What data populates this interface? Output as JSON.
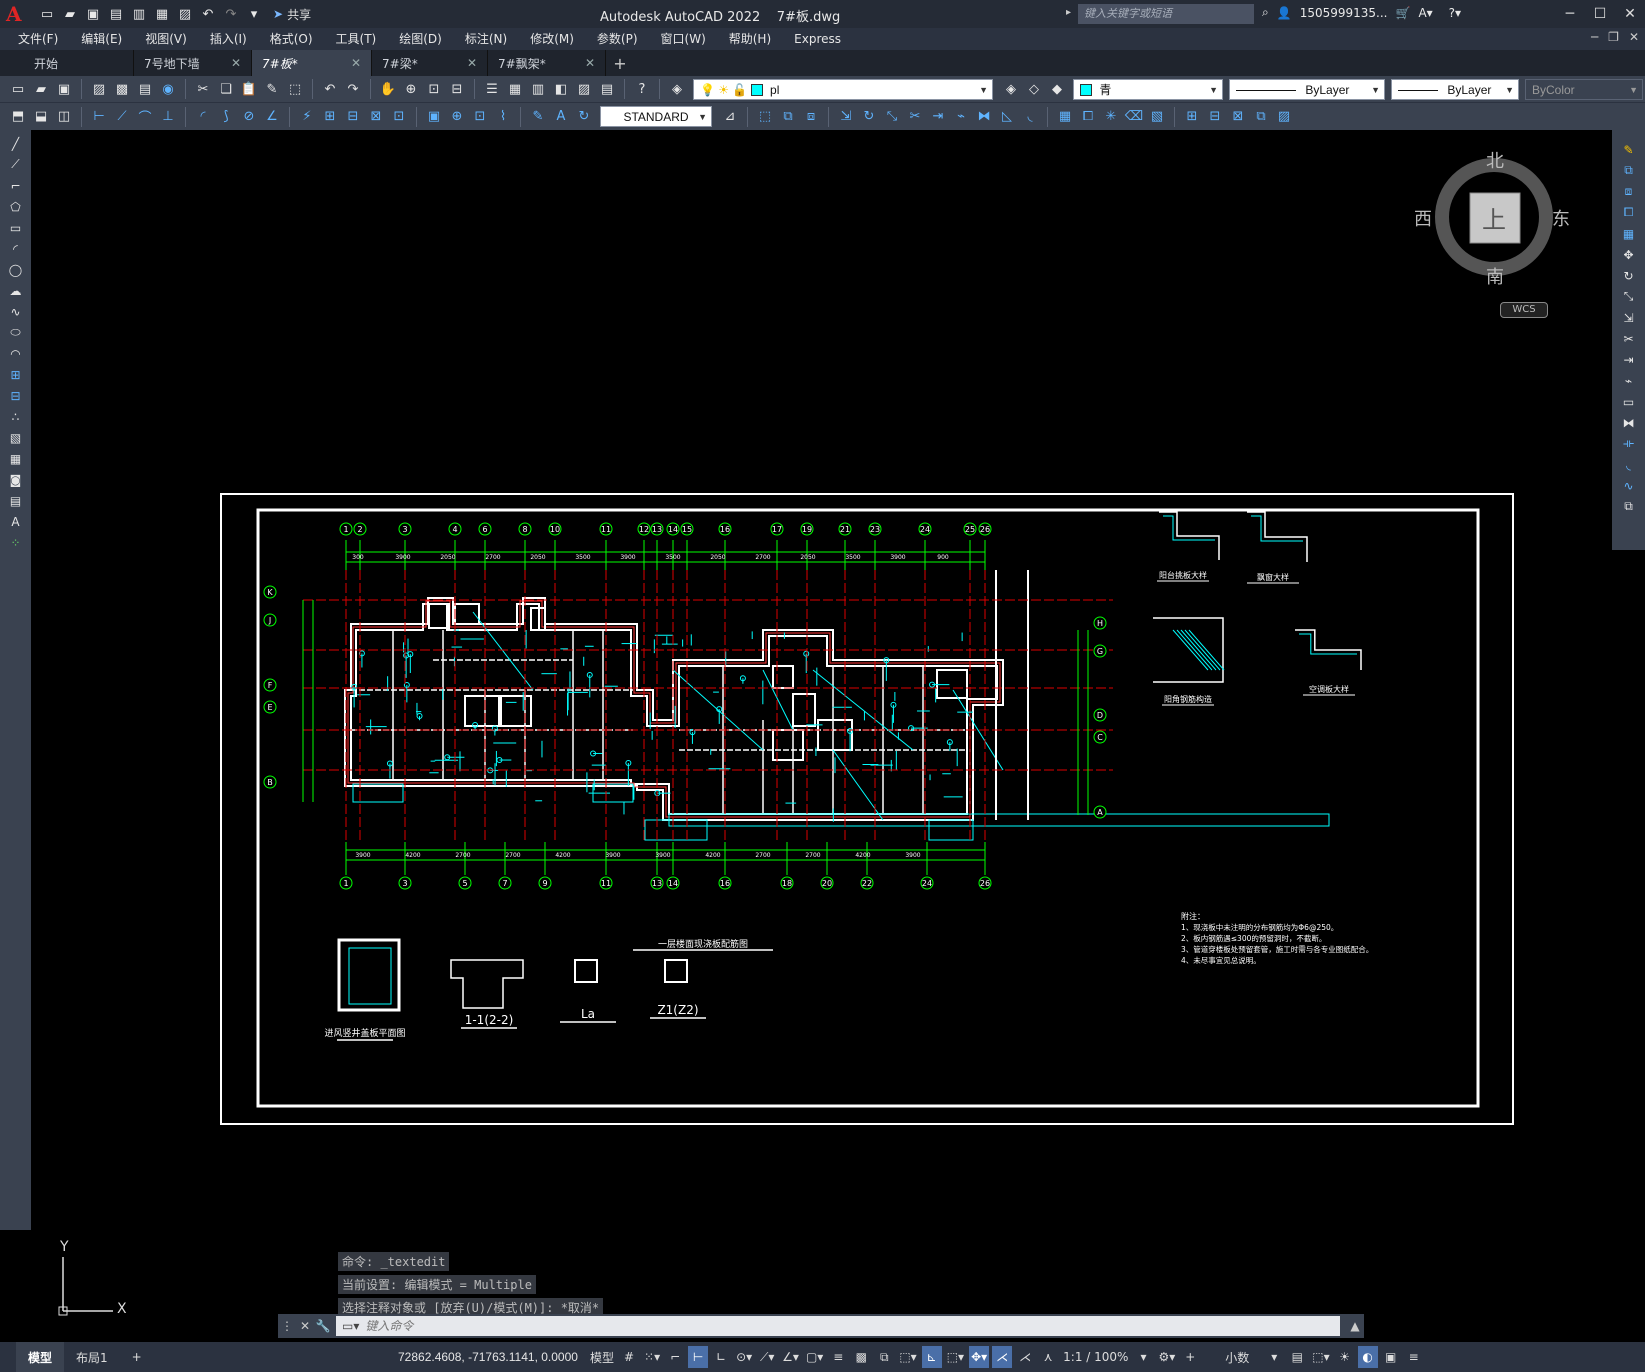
{
  "app": {
    "logo": "A",
    "title": "Autodesk AutoCAD 2022",
    "file": "7#板.dwg",
    "share_label": "共享",
    "search_placeholder": "键入关键字或短语",
    "user": "1505999135...",
    "accent": "#e02525"
  },
  "menu": [
    "文件(F)",
    "编辑(E)",
    "视图(V)",
    "插入(I)",
    "格式(O)",
    "工具(T)",
    "绘图(D)",
    "标注(N)",
    "修改(M)",
    "参数(P)",
    "窗口(W)",
    "帮助(H)",
    "Express"
  ],
  "tabs": [
    {
      "label": "开始",
      "active": false,
      "closable": false
    },
    {
      "label": "7号地下墙",
      "active": false,
      "closable": true
    },
    {
      "label": "7#板*",
      "active": true,
      "closable": true
    },
    {
      "label": "7#梁*",
      "active": false,
      "closable": true
    },
    {
      "label": "7#飘架*",
      "active": false,
      "closable": true
    }
  ],
  "toolbar": {
    "layer": "pl",
    "color": "青",
    "linetype": "ByLayer",
    "lineweight": "ByLayer",
    "plotstyle": "ByColor",
    "textstyle": "STANDARD"
  },
  "viewcube": {
    "north": "北",
    "south": "南",
    "east": "东",
    "west": "西",
    "top": "上",
    "wcs": "WCS"
  },
  "command": {
    "history": [
      "命令: _textedit",
      "当前设置: 编辑模式 = Multiple",
      "选择注释对象或 [放弃(U)/模式(M)]: *取消*"
    ],
    "placeholder": "键入命令"
  },
  "ucs": {
    "x": "X",
    "y": "Y"
  },
  "status": {
    "tabs": [
      {
        "label": "模型",
        "active": true
      },
      {
        "label": "布局1",
        "active": false
      }
    ],
    "coords": "72862.4608, -71763.1141, 0.0000",
    "model_label": "模型",
    "scale": "1:1 / 100%",
    "units": "小数"
  },
  "drawing": {
    "title": "一层楼面现浇板配筋图",
    "details": [
      "阳台挑板大样",
      "飘窗大样",
      "阳角钢筋构造",
      "空调板大样"
    ],
    "notes_title": "附注：",
    "notes": [
      "1、现浇板中未注明的分布钢筋均为Φ6@250。",
      "2、板内钢筋遇≤300的预留洞时，不截断。",
      "3、管道穿楼板处预留套管，施工时需与各专业图纸配合。",
      "4、未尽事宜见总说明。"
    ],
    "sections": [
      "进风竖井盖板平面图",
      "1-1(2-2)",
      "La",
      "Z1(Z2)"
    ],
    "axes_top": [
      "1",
      "2",
      "3",
      "4",
      "6",
      "8",
      "10",
      "11",
      "12",
      "13",
      "14",
      "15",
      "16",
      "17",
      "19",
      "21",
      "23",
      "24",
      "25",
      "26"
    ],
    "axes_bottom": [
      "1",
      "3",
      "5",
      "7",
      "9",
      "11",
      "13",
      "14",
      "16",
      "18",
      "20",
      "22",
      "24",
      "26"
    ],
    "axes_left": [
      "K",
      "J",
      "F",
      "E",
      "B"
    ],
    "axes_right": [
      "H",
      "G",
      "D",
      "C",
      "A"
    ],
    "dims_top": [
      "300",
      "3900",
      "2050",
      "2700",
      "2050",
      "3500",
      "3900",
      "3500",
      "2050",
      "2700",
      "2050",
      "3500",
      "3900",
      "900"
    ],
    "dims_bottom": [
      "3900",
      "4200",
      "2700",
      "2700",
      "4200",
      "3900",
      "3900",
      "4200",
      "2700",
      "2700",
      "4200",
      "3900"
    ]
  }
}
